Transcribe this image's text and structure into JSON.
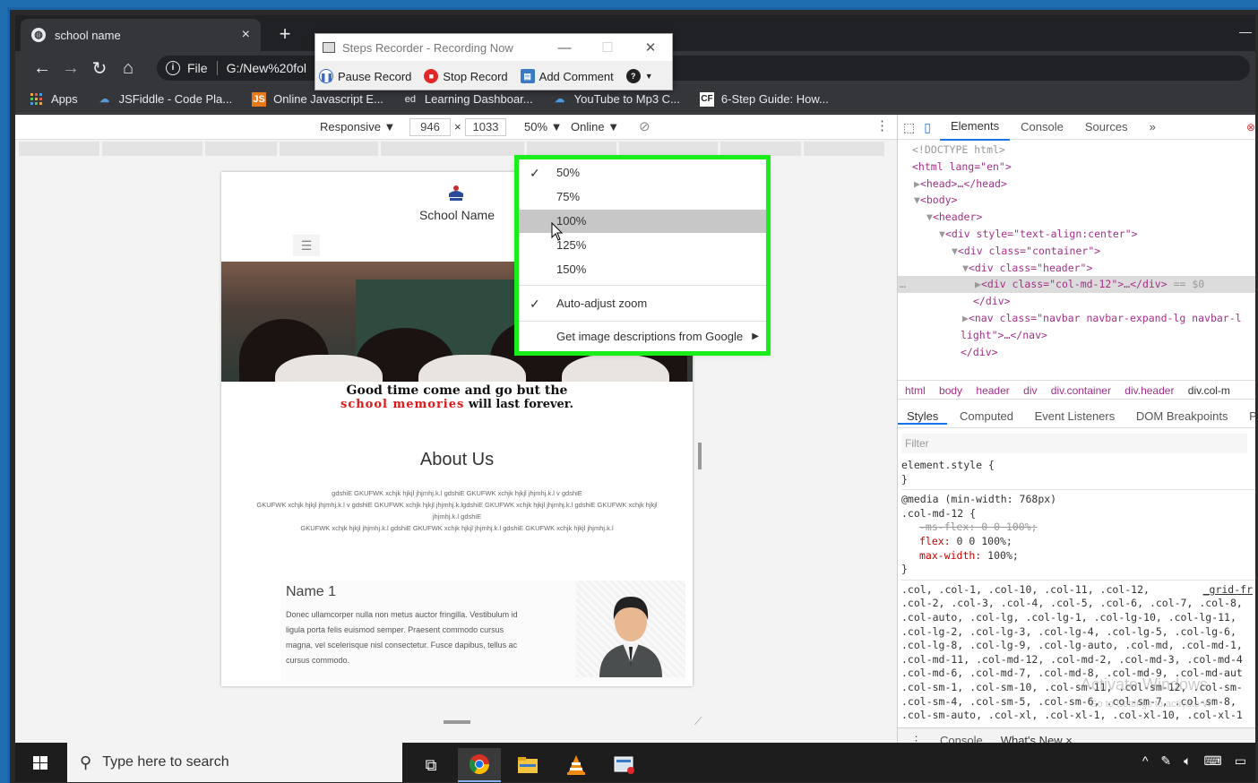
{
  "browser": {
    "tab_title": "school name",
    "tab_close": "×",
    "new_tab": "+",
    "address_prefix": "File",
    "address": "G:/New%20fol",
    "bookmarks": [
      {
        "label": "Apps",
        "icon": "apps-grid-icon"
      },
      {
        "label": "JSFiddle - Code Pla...",
        "icon": "jsfiddle-icon"
      },
      {
        "label": "Online Javascript E...",
        "icon": "js-icon"
      },
      {
        "label": "Learning Dashboar...",
        "icon": "ed-icon"
      },
      {
        "label": "YouTube to Mp3 C...",
        "icon": "cloud-icon"
      },
      {
        "label": "6-Step Guide: How...",
        "icon": "cf-icon"
      }
    ]
  },
  "recorder": {
    "title": "Steps Recorder - Recording Now",
    "pause": "Pause Record",
    "stop": "Stop Record",
    "comment": "Add Comment"
  },
  "device_toolbar": {
    "mode": "Responsive",
    "width": "946",
    "times": "×",
    "height": "1033",
    "zoom": "50%",
    "network": "Online"
  },
  "zoom_menu": {
    "options": [
      "50%",
      "75%",
      "100%",
      "125%",
      "150%"
    ],
    "selected": "50%",
    "hovered": "100%",
    "auto_adjust": "Auto-adjust zoom",
    "image_desc": "Get image descriptions from Google"
  },
  "page": {
    "school_name": "School Name",
    "quote_line1": "Good time come and go but the",
    "quote_red": "school memories",
    "quote_rest": " will last forever.",
    "about_title": "About Us",
    "lorem_1": "gdshiE GKUFWK xchjk hjkjl jhjmhj.k.l gdshiE GKUFWK xchjk hjkjl jhjmhj.k.l v gdshiE",
    "lorem_2": "GKUFWK xchjk hjkjl jhjmhj.k.l v gdshiE GKUFWK xchjk hjkjl jhjmhj.k.lgdshiE GKUFWK xchjk hjkjl jhjmhj.k.l gdshiE GKUFWK xchjk hjkjl",
    "lorem_3": "jhjmhj.k.l gdshiE",
    "lorem_4": "GKUFWK xchjk hjkjl jhjmhj.k.l gdshiE GKUFWK xchjk hjkjl jhjmhj.k.l gdshiE GKUFWK xchjk hjkjl jhjmhj.k.l",
    "card_name": "Name 1",
    "card_desc": "Donec ullamcorper nulla non metus auctor fringilla. Vestibulum id ligula porta felis euismod semper. Praesent commodo cursus magna, vel scelerisque nisl consectetur. Fusce dapibus, tellus ac cursus commodo."
  },
  "devtools": {
    "tabs": [
      "Elements",
      "Console",
      "Sources",
      "»"
    ],
    "dom": {
      "doctype": "<!DOCTYPE html>",
      "html_open": "<html lang=\"en\">",
      "head": "<head>…</head>",
      "body": "<body>",
      "header": "<header>",
      "div_style": "<div style=\"text-align:center\">",
      "div_container": "<div class=\"container\">",
      "div_header": "<div class=\"header\">",
      "div_col": "<div class=\"col-md-12\">…</div>",
      "col_suffix": " == $0",
      "div_close": "</div>",
      "nav": "<nav class=\"navbar navbar-expand-lg navbar-l",
      "nav_cont": "light\">…</nav>",
      "div_close2": "</div>"
    },
    "breadcrumbs": [
      "html",
      "body",
      "header",
      "div",
      "div.container",
      "div.header",
      "div.col-m"
    ],
    "style_tabs": [
      "Styles",
      "Computed",
      "Event Listeners",
      "DOM Breakpoints",
      "Pro"
    ],
    "filter_placeholder": "Filter",
    "styles": {
      "element_style": "element.style {",
      "close": "}",
      "media": "@media (min-width: 768px)",
      "selector": ".col-md-12 {",
      "ms_flex": "-ms-flex: 0 0 100%;",
      "flex_name": "flex:",
      "flex_val": " 0 0 100%;",
      "maxw_name": "max-width:",
      "maxw_val": " 100%;",
      "grid_link": "_grid-fr",
      "cols": [
        ".col, .col-1, .col-10, .col-11, .col-12,",
        ".col-2, .col-3, .col-4, .col-5, .col-6, .col-7, .col-8,",
        ".col-auto, .col-lg, .col-lg-1, .col-lg-10, .col-lg-11,",
        ".col-lg-2, .col-lg-3, .col-lg-4, .col-lg-5, .col-lg-6,",
        ".col-lg-8, .col-lg-9, .col-lg-auto, .col-md, .col-md-1,",
        ".col-md-11, .col-md-12, .col-md-2, .col-md-3, .col-md-4",
        ".col-md-6, .col-md-7, .col-md-8, .col-md-9, .col-md-aut",
        ".col-sm-1, .col-sm-10, .col-sm-11, .col-sm-12, .col-sm-",
        ".col-sm-4, .col-sm-5, .col-sm-6, .col-sm-7, .col-sm-8,",
        ".col-sm-auto, .col-xl, .col-xl-1, .col-xl-10, .col-xl-1"
      ]
    },
    "drawer": [
      "Console",
      "What's New ×"
    ],
    "watermark": "Activate Windows",
    "watermark2": "Go to Settings to activate W"
  },
  "taskbar": {
    "search_placeholder": "Type here to search"
  },
  "colors": {
    "highlight": "#1aee1a",
    "accent": "#1a73e8",
    "red_quote": "#e01818"
  }
}
